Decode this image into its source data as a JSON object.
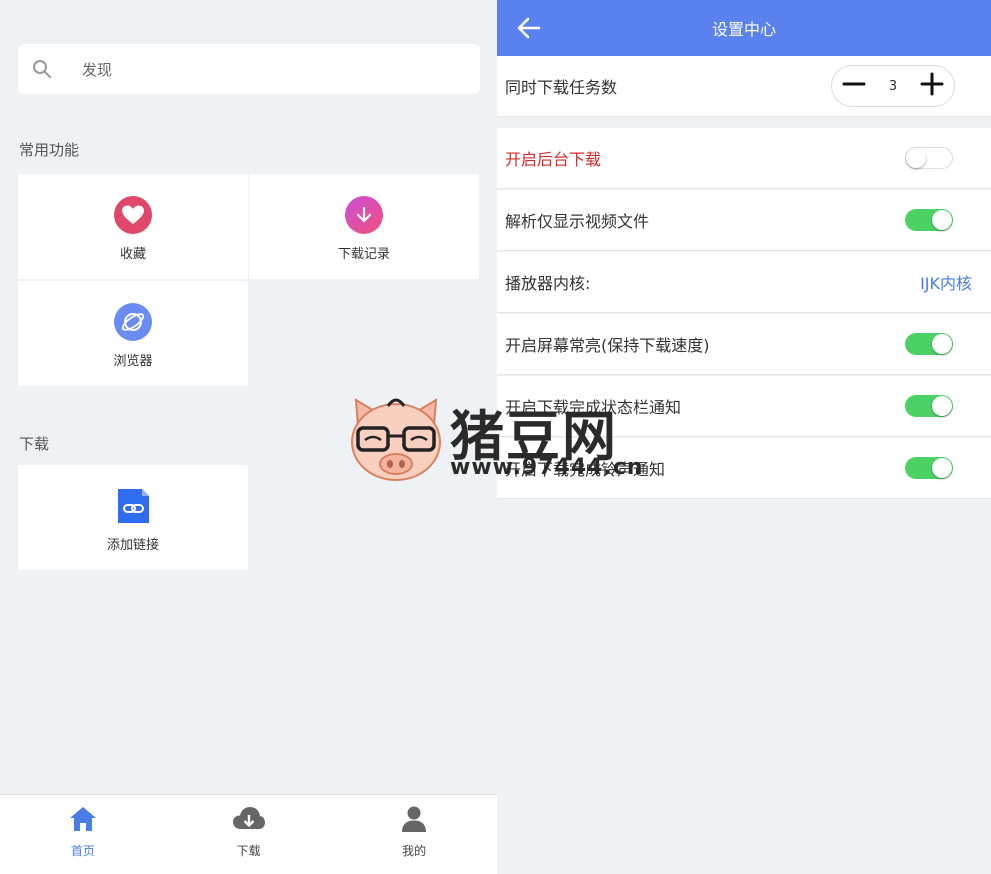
{
  "left": {
    "search": {
      "placeholder": "发现",
      "icon": "search-icon"
    },
    "sections": {
      "common": "常用功能",
      "download": "下载"
    },
    "common_items": [
      {
        "label": "收藏",
        "icon": "heart-icon",
        "color": "#e0476a"
      },
      {
        "label": "下载记录",
        "icon": "download-arrow-icon",
        "color": "#d84fa0"
      },
      {
        "label": "浏览器",
        "icon": "planet-icon",
        "color": "#6b8cf0"
      }
    ],
    "download_items": [
      {
        "label": "添加链接",
        "icon": "link-file-icon",
        "color": "#2f6cf0"
      }
    ],
    "tabbar": [
      {
        "label": "首页",
        "icon": "home-icon",
        "active": true
      },
      {
        "label": "下载",
        "icon": "cloud-download-icon",
        "active": false
      },
      {
        "label": "我的",
        "icon": "user-icon",
        "active": false
      }
    ]
  },
  "right": {
    "header": {
      "title": "设置中心",
      "back_icon": "back-arrow-icon",
      "color": "#5a82ef"
    },
    "task_count": {
      "label": "同时下载任务数",
      "value": "3"
    },
    "settings": [
      {
        "label": "开启后台下载",
        "toggle": false,
        "highlight": true
      },
      {
        "label": "解析仅显示视频文件",
        "toggle": true
      },
      {
        "label": "播放器内核:",
        "value": "IJK内核"
      },
      {
        "label": "开启屏幕常亮(保持下载速度)",
        "toggle": true
      },
      {
        "label": "开启下载完成状态栏通知",
        "toggle": true
      },
      {
        "label": "开启下载完成铃声通知",
        "toggle": true
      }
    ]
  },
  "watermark": {
    "brand": "猪豆网",
    "site": "www.97444.cn"
  },
  "colors": {
    "accent": "#4a7de8",
    "toggle_on": "#4cd264",
    "danger": "#d42b2b"
  }
}
